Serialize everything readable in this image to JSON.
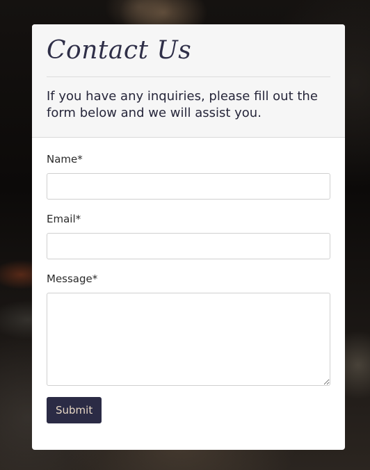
{
  "contact": {
    "title": "Contact Us",
    "subtitle": "If you have any inquiries, please fill out the form below and we will assist you.",
    "fields": {
      "name": {
        "label": "Name*",
        "value": "",
        "placeholder": ""
      },
      "email": {
        "label": "Email*",
        "value": "",
        "placeholder": ""
      },
      "message": {
        "label": "Message*",
        "value": "",
        "placeholder": ""
      }
    },
    "submit_label": "Submit"
  },
  "colors": {
    "accent": "#2b2b45",
    "button_text": "#e6d6c4",
    "header_bg": "#f6f6f6"
  }
}
